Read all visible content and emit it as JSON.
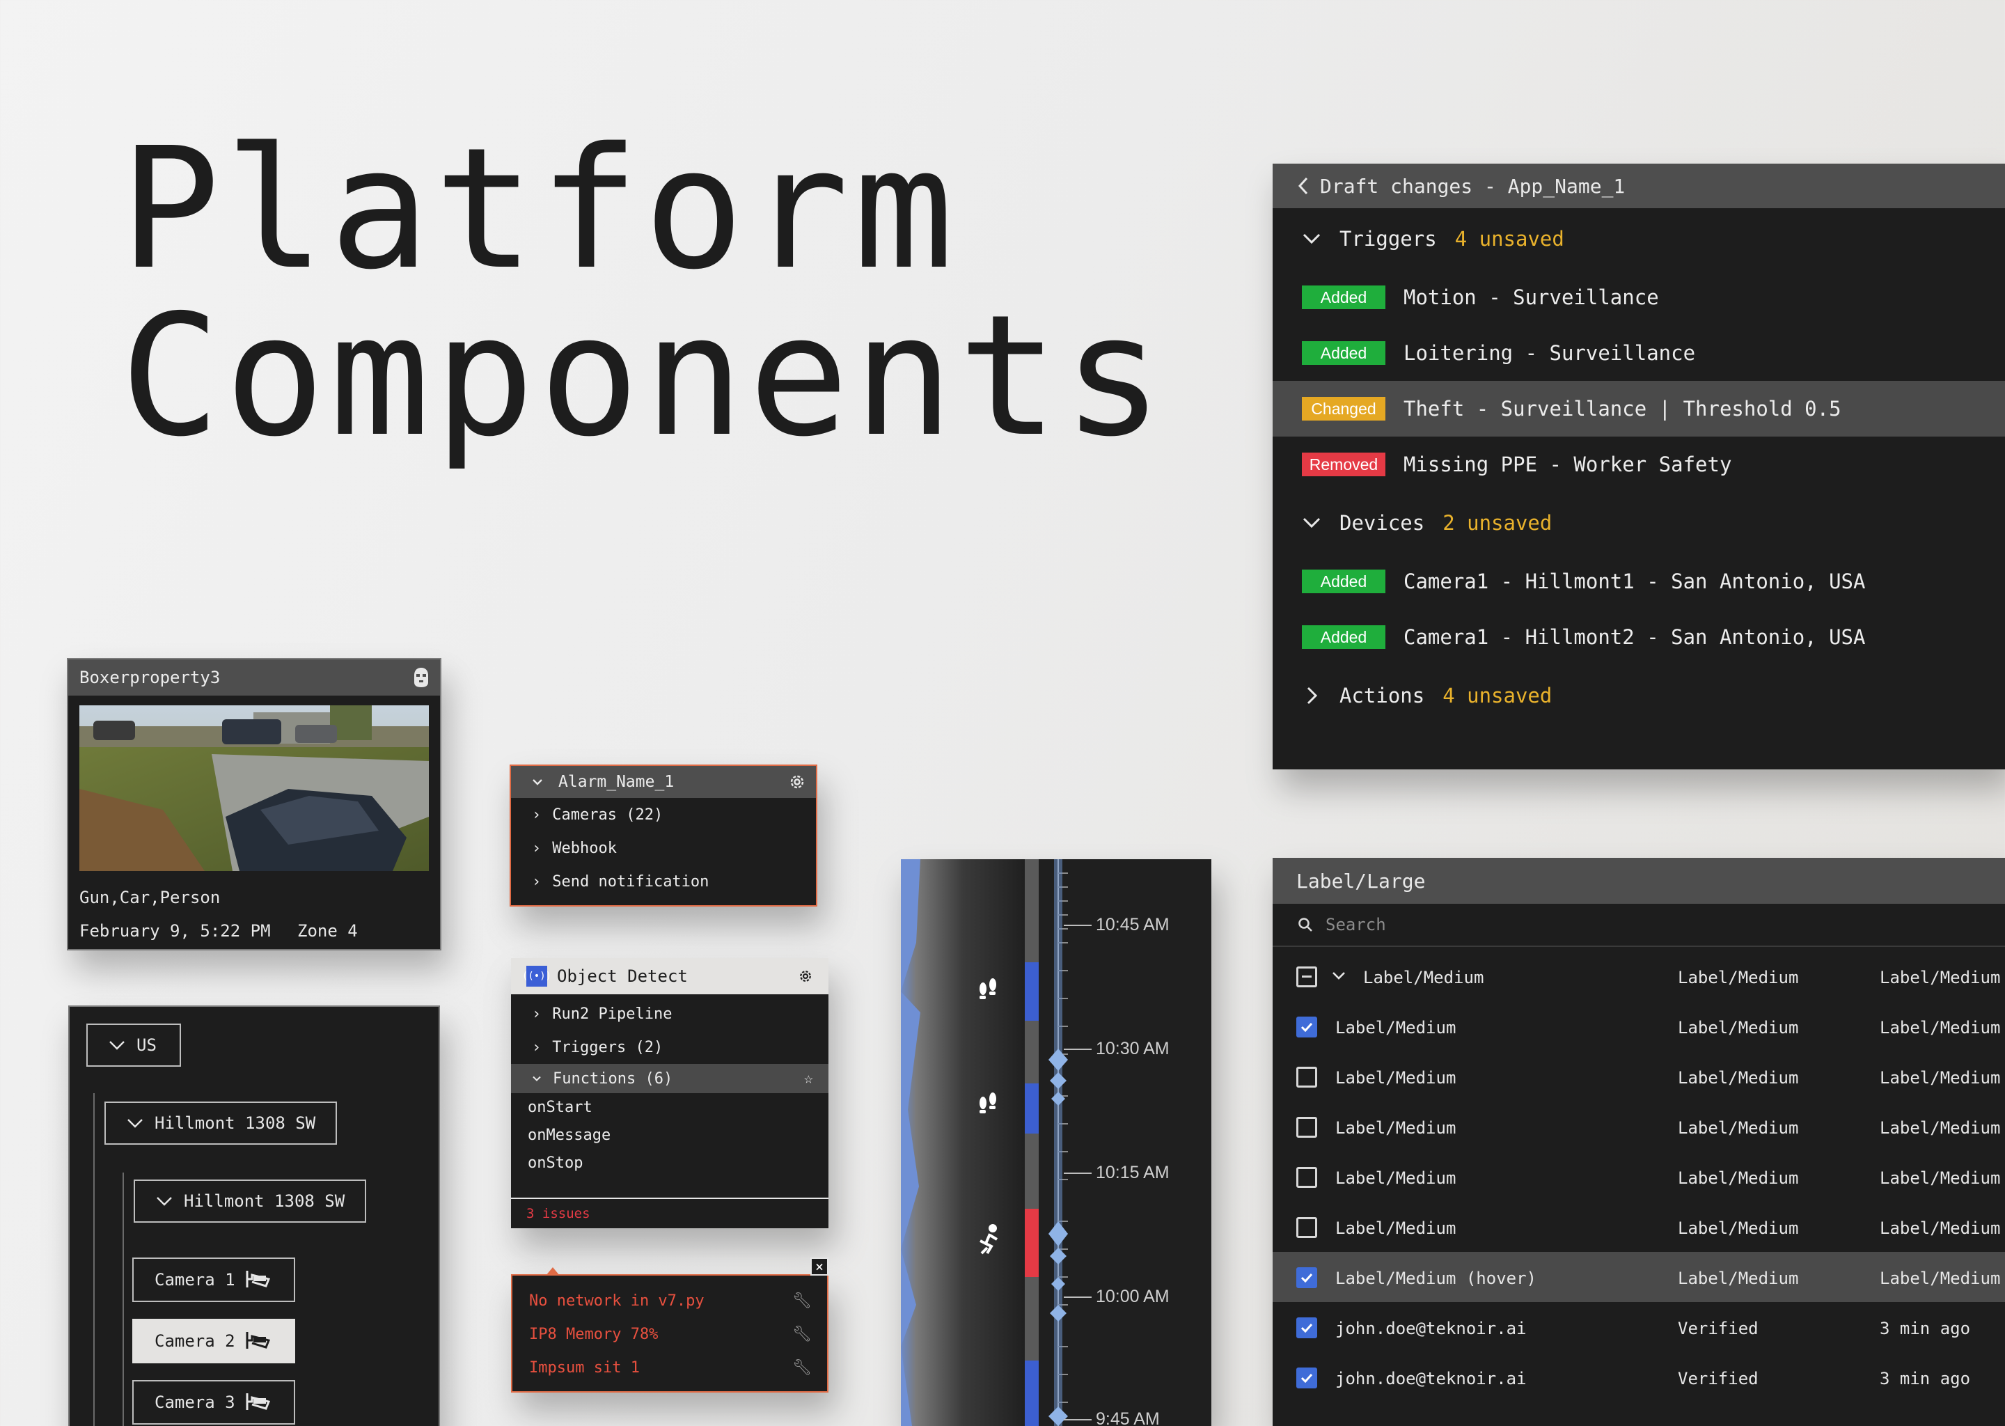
{
  "hero": {
    "line1": "Platform",
    "line2": "Components"
  },
  "draft": {
    "title": "Draft changes - App_Name_1",
    "triggers": {
      "label": "Triggers",
      "unsaved": "4 unsaved"
    },
    "trigger_items": [
      {
        "badge": "Added",
        "text": "Motion - Surveillance"
      },
      {
        "badge": "Added",
        "text": "Loitering - Surveillance"
      },
      {
        "badge": "Changed",
        "text": "Theft - Surveillance | Threshold 0.5"
      },
      {
        "badge": "Removed",
        "text": "Missing PPE - Worker Safety"
      }
    ],
    "devices": {
      "label": "Devices",
      "unsaved": "2 unsaved"
    },
    "device_items": [
      {
        "badge": "Added",
        "text": "Camera1 - Hillmont1 - San Antonio, USA"
      },
      {
        "badge": "Added",
        "text": "Camera1 - Hillmont2 - San Antonio, USA"
      }
    ],
    "actions": {
      "label": "Actions",
      "unsaved": "4 unsaved"
    },
    "colors": {
      "added": "#1fae3c",
      "changed": "#e5a823",
      "removed": "#e53a45",
      "unsaved": "#e9b22c"
    }
  },
  "camera_card": {
    "title": "Boxerproperty3",
    "icon": "mask-icon",
    "labels": "Gun,Car,Person",
    "timestamp": "February 9, 5:22 PM",
    "zone": "Zone 4"
  },
  "alarm": {
    "title": "Alarm_Name_1",
    "items": [
      "Cameras (22)",
      "Webhook",
      "Send notification"
    ]
  },
  "object_detect": {
    "title": "Object Detect",
    "items": [
      "Run2 Pipeline",
      "Triggers (2)"
    ],
    "functions_label": "Functions (6)",
    "functions": [
      "onStart",
      "onMessage",
      "onStop"
    ],
    "issues": "3 issues"
  },
  "errors": {
    "items": [
      "No network in v7.py",
      "IP8 Memory 78%",
      "Impsum sit 1"
    ]
  },
  "location_tree": {
    "root": "US",
    "level1": "Hillmont 1308 SW",
    "level2": "Hillmont 1308 SW",
    "cameras": [
      "Camera 1",
      "Camera 2",
      "Camera 3"
    ],
    "selected_camera": "Camera 2"
  },
  "timeline": {
    "times": [
      "10:45 AM",
      "10:30 AM",
      "10:15 AM",
      "10:00 AM",
      "9:45 AM"
    ],
    "events": [
      "footprints-icon",
      "footprints-icon",
      "running-person-icon"
    ]
  },
  "table": {
    "title": "Label/Large",
    "search_placeholder": "Search",
    "header_row": {
      "c1": "Label/Medium",
      "c2": "Label/Medium",
      "c3": "Label/Medium"
    },
    "rows": [
      {
        "checked": true,
        "c1": "Label/Medium",
        "c2": "Label/Medium",
        "c3": "Label/Medium"
      },
      {
        "checked": false,
        "c1": "Label/Medium",
        "c2": "Label/Medium",
        "c3": "Label/Medium"
      },
      {
        "checked": false,
        "c1": "Label/Medium",
        "c2": "Label/Medium",
        "c3": "Label/Medium"
      },
      {
        "checked": false,
        "c1": "Label/Medium",
        "c2": "Label/Medium",
        "c3": "Label/Medium"
      },
      {
        "checked": false,
        "c1": "Label/Medium",
        "c2": "Label/Medium",
        "c3": "Label/Medium"
      },
      {
        "checked": true,
        "c1": "Label/Medium (hover)",
        "c2": "Label/Medium",
        "c3": "Label/Medium"
      },
      {
        "checked": true,
        "c1": "john.doe@teknoir.ai",
        "c2": "Verified",
        "c3": "3 min ago"
      },
      {
        "checked": true,
        "c1": "john.doe@teknoir.ai",
        "c2": "Verified",
        "c3": "3 min ago"
      }
    ],
    "accent": "#3f6cd8"
  }
}
